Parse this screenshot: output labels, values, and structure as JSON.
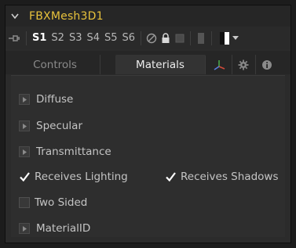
{
  "node": {
    "title": "FBXMesh3D1"
  },
  "toolbar": {
    "slots": [
      "S1",
      "S2",
      "S3",
      "S4",
      "S5",
      "S6"
    ],
    "active_slot": "S1"
  },
  "tabs": [
    {
      "label": "Controls",
      "active": false
    },
    {
      "label": "Materials",
      "active": true
    }
  ],
  "panel": {
    "sections": [
      {
        "label": "Diffuse"
      },
      {
        "label": "Specular"
      },
      {
        "label": "Transmittance"
      }
    ],
    "receives_lighting": {
      "label": "Receives Lighting",
      "checked": true
    },
    "receives_shadows": {
      "label": "Receives Shadows",
      "checked": true
    },
    "two_sided": {
      "label": "Two Sided",
      "checked": false
    },
    "material_id": {
      "label": "MaterialID"
    }
  },
  "colors": {
    "title_accent": "#e8c23c",
    "axis_icon_red": "#d04a3a",
    "axis_icon_green": "#4aa64a",
    "axis_icon_blue": "#5a7ee0"
  }
}
